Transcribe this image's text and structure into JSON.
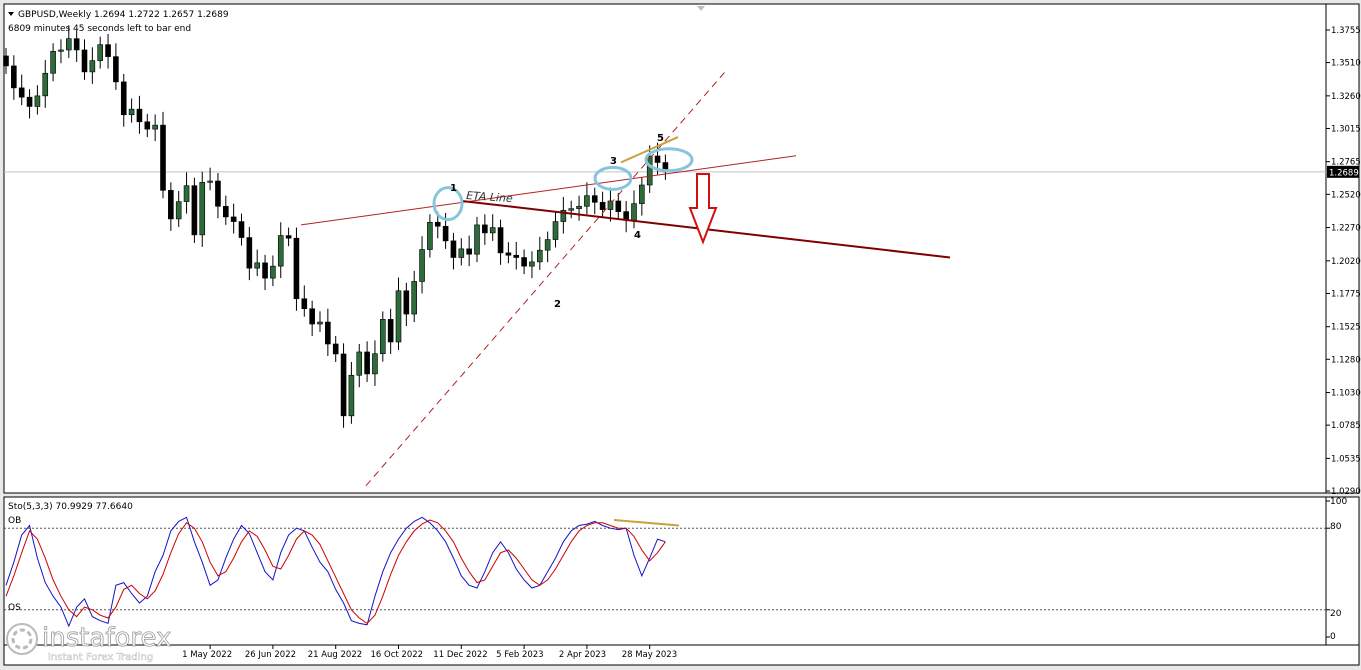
{
  "header": {
    "symbol_line": "GBPUSD,Weekly  1.2694 1.2722 1.2657 1.2689",
    "timer": "6809 minutes 45 seconds left to bar end"
  },
  "annotations": {
    "eta_label": "ETA Line",
    "wave_labels": [
      "1",
      "2",
      "3",
      "4",
      "5"
    ]
  },
  "stochastic": {
    "title": "Sto(5,3,3) 70.9929 77.6640",
    "ob_label": "OB",
    "os_label": "OS",
    "levels": [
      80,
      20
    ],
    "ticks": [
      "100",
      "80",
      "20",
      "0"
    ]
  },
  "watermark": {
    "brand": "instaforex",
    "tagline": "Instant Forex Trading"
  },
  "colors": {
    "bull": "#2e6b3a",
    "bear": "#000000",
    "eta_line": "#800000",
    "channel": "#b22222",
    "circles": "#87c4dd",
    "divergence": "#c8a03c",
    "arrow": "#d01010",
    "sto_main": "#1414c8",
    "sto_signal": "#d00000"
  },
  "chart_data": [
    {
      "type": "candlestick",
      "title": "GBPUSD,Weekly",
      "ohlc_last": {
        "open": 1.2694,
        "high": 1.2722,
        "low": 1.2657,
        "close": 1.2689
      },
      "current_price": "1.2689",
      "y_ticks": [
        "1.3755",
        "1.3510",
        "1.3260",
        "1.3015",
        "1.2765",
        "1.2520",
        "1.2270",
        "1.2020",
        "1.1775",
        "1.1525",
        "1.1280",
        "1.1030",
        "1.0785",
        "1.0535",
        "1.0290"
      ],
      "ylim": [
        1.029,
        1.3755
      ],
      "x_ticks": [
        "1 May 2022",
        "26 Jun 2022",
        "21 Aug 2022",
        "16 Oct 2022",
        "11 Dec 2022",
        "5 Feb 2023",
        "2 Apr 2023",
        "28 May 2023"
      ],
      "closes": [
        1.3485,
        1.332,
        1.325,
        1.318,
        1.326,
        1.343,
        1.3595,
        1.3605,
        1.369,
        1.3605,
        1.344,
        1.3525,
        1.3645,
        1.3555,
        1.3365,
        1.3118,
        1.316,
        1.3065,
        1.301,
        1.304,
        1.255,
        1.2335,
        1.2465,
        1.2585,
        1.2215,
        1.261,
        1.262,
        1.243,
        1.235,
        1.2315,
        1.2195,
        1.1965,
        1.2005,
        1.189,
        1.198,
        1.221,
        1.219,
        1.1735,
        1.166,
        1.1545,
        1.156,
        1.1395,
        1.132,
        1.0855,
        1.116,
        1.1335,
        1.117,
        1.1322,
        1.158,
        1.141,
        1.1795,
        1.162,
        1.1865,
        1.2105,
        1.231,
        1.228,
        1.217,
        1.2045,
        1.211,
        1.207,
        1.229,
        1.223,
        1.227,
        1.208,
        1.2062,
        1.2045,
        1.198,
        1.2012,
        1.21,
        1.218,
        1.2315,
        1.24,
        1.2412,
        1.243,
        1.251,
        1.246,
        1.2405,
        1.247,
        1.239,
        1.2325,
        1.245,
        1.259,
        1.2808,
        1.2759,
        1.2689
      ],
      "wave_points": [
        "1",
        "2",
        "3",
        "4",
        "5"
      ],
      "eta_line": "ETA Line"
    },
    {
      "type": "line",
      "title": "Sto(5,3,3)",
      "main_last": 70.9929,
      "signal_last": 77.664,
      "ylim": [
        0,
        100
      ],
      "y_ticks": [
        100,
        80,
        20,
        0
      ],
      "series": [
        {
          "name": "Sto main",
          "values": [
            38,
            55,
            75,
            82,
            58,
            40,
            30,
            22,
            8,
            22,
            28,
            15,
            12,
            10,
            38,
            40,
            32,
            25,
            30,
            48,
            60,
            78,
            85,
            88,
            70,
            55,
            38,
            42,
            58,
            72,
            82,
            76,
            62,
            48,
            42,
            62,
            75,
            80,
            78,
            66,
            55,
            48,
            35,
            25,
            12,
            10,
            9,
            30,
            48,
            62,
            72,
            80,
            85,
            88,
            84,
            78,
            70,
            58,
            45,
            38,
            36,
            48,
            62,
            70,
            62,
            50,
            42,
            36,
            38,
            48,
            58,
            70,
            78,
            82,
            83,
            85,
            82,
            80,
            79,
            80,
            60,
            45,
            58,
            72,
            70
          ]
        },
        {
          "name": "Sto signal",
          "values": [
            30,
            45,
            62,
            78,
            72,
            58,
            42,
            30,
            20,
            15,
            22,
            20,
            16,
            14,
            22,
            35,
            38,
            32,
            28,
            34,
            46,
            62,
            76,
            84,
            80,
            70,
            55,
            45,
            48,
            58,
            70,
            78,
            74,
            64,
            52,
            50,
            60,
            72,
            78,
            75,
            68,
            56,
            44,
            32,
            20,
            14,
            10,
            16,
            30,
            46,
            60,
            70,
            78,
            83,
            86,
            84,
            78,
            70,
            58,
            48,
            40,
            42,
            52,
            62,
            64,
            58,
            50,
            42,
            38,
            42,
            50,
            60,
            70,
            78,
            82,
            84,
            84,
            82,
            80,
            80,
            74,
            64,
            56,
            62,
            70
          ]
        }
      ]
    }
  ]
}
